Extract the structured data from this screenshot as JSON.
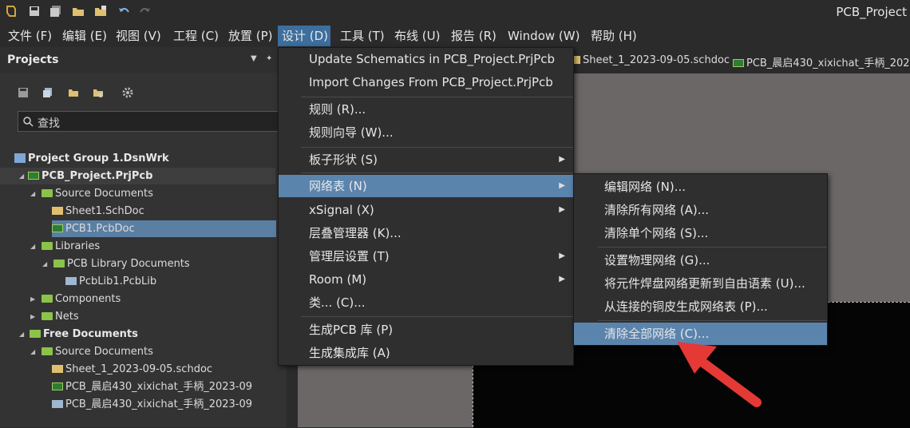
{
  "app": {
    "title": "PCB_Project"
  },
  "colors": {
    "accent": "#5b84ad",
    "menu_active": "#3c6e9e",
    "annotation_arrow": "#e53935"
  },
  "toolbar": {
    "icons": [
      "app-logo-icon",
      "save-icon",
      "save-all-icon",
      "open-folder-icon",
      "open-project-icon",
      "undo-icon",
      "redo-icon"
    ]
  },
  "menubar": {
    "items": [
      {
        "label": "文件 (F)"
      },
      {
        "label": "编辑 (E)"
      },
      {
        "label": "视图 (V)"
      },
      {
        "label": "工程 (C)"
      },
      {
        "label": "放置 (P)"
      },
      {
        "label": "设计 (D)"
      },
      {
        "label": "工具 (T)"
      },
      {
        "label": "布线 (U)"
      },
      {
        "label": "报告 (R)"
      },
      {
        "label": "Window (W)"
      },
      {
        "label": "帮助 (H)"
      }
    ]
  },
  "projects_panel": {
    "title": "Projects",
    "search_placeholder": "查找",
    "tree": [
      {
        "label": "Project Group 1.DsnWrk"
      },
      {
        "label": "PCB_Project.PrjPcb"
      },
      {
        "label": "Source Documents"
      },
      {
        "label": "Sheet1.SchDoc"
      },
      {
        "label": "PCB1.PcbDoc"
      },
      {
        "label": "Libraries"
      },
      {
        "label": "PCB Library Documents"
      },
      {
        "label": "PcbLib1.PcbLib"
      },
      {
        "label": "Components"
      },
      {
        "label": "Nets"
      },
      {
        "label": "Free Documents"
      },
      {
        "label": "Source Documents"
      },
      {
        "label": "Sheet_1_2023-09-05.schdoc"
      },
      {
        "label": "PCB_晨启430_xixichat_手柄_2023-09"
      },
      {
        "label": "PCB_晨启430_xixichat_手柄_2023-09"
      }
    ]
  },
  "doc_tabs": [
    {
      "label": "Sheet_1_2023-09-05.schdoc"
    },
    {
      "label": "PCB_晨启430_xixichat_手柄_2023"
    }
  ],
  "design_menu": {
    "items": [
      {
        "label": "Update Schematics in PCB_Project.PrjPcb"
      },
      {
        "label": "Import Changes From PCB_Project.PrjPcb"
      },
      {
        "label": "规则 (R)..."
      },
      {
        "label": "规则向导 (W)..."
      },
      {
        "label": "板子形状 (S)"
      },
      {
        "label": "网络表 (N)"
      },
      {
        "label": "xSignal (X)"
      },
      {
        "label": "层叠管理器 (K)..."
      },
      {
        "label": "管理层设置 (T)"
      },
      {
        "label": "Room (M)"
      },
      {
        "label": "类... (C)..."
      },
      {
        "label": "生成PCB 库 (P)"
      },
      {
        "label": "生成集成库 (A)"
      }
    ]
  },
  "netlist_submenu": {
    "items": [
      {
        "label": "编辑网络 (N)..."
      },
      {
        "label": "清除所有网络 (A)..."
      },
      {
        "label": "清除单个网络 (S)..."
      },
      {
        "label": "设置物理网络 (G)..."
      },
      {
        "label": "将元件焊盘网络更新到自由语素 (U)..."
      },
      {
        "label": "从连接的铜皮生成网络表 (P)..."
      },
      {
        "label": "清除全部网络 (C)..."
      }
    ]
  }
}
